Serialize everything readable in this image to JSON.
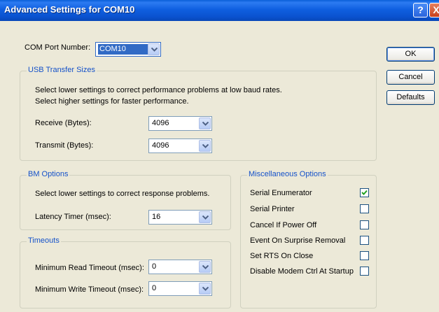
{
  "window": {
    "title": "Advanced Settings for COM10",
    "help_glyph": "?",
    "close_glyph": "X"
  },
  "com_port": {
    "label": "COM Port Number:",
    "value": "COM10"
  },
  "buttons": {
    "ok": "OK",
    "cancel": "Cancel",
    "defaults": "Defaults"
  },
  "usb": {
    "title": "USB Transfer Sizes",
    "line1": "Select lower settings to correct performance problems at low baud rates.",
    "line2": "Select higher settings for faster performance.",
    "receive_label": "Receive (Bytes):",
    "receive_value": "4096",
    "transmit_label": "Transmit (Bytes):",
    "transmit_value": "4096"
  },
  "bm": {
    "title": "BM Options",
    "line1": "Select lower settings to correct response problems.",
    "latency_label": "Latency Timer (msec):",
    "latency_value": "16"
  },
  "timeouts": {
    "title": "Timeouts",
    "read_label": "Minimum Read Timeout (msec):",
    "read_value": "0",
    "write_label": "Minimum Write Timeout (msec):",
    "write_value": "0"
  },
  "misc": {
    "title": "Miscellaneous Options",
    "options": [
      {
        "label": "Serial Enumerator",
        "checked": true
      },
      {
        "label": "Serial Printer",
        "checked": false
      },
      {
        "label": "Cancel If Power Off",
        "checked": false
      },
      {
        "label": "Event On Surprise Removal",
        "checked": false
      },
      {
        "label": "Set RTS On Close",
        "checked": false
      },
      {
        "label": "Disable Modem Ctrl At Startup",
        "checked": false
      }
    ]
  },
  "icons": {
    "dropdown": "chevron-down-icon",
    "check": "checkmark-icon"
  },
  "colors": {
    "titlebar": "#0a52cf",
    "group_label": "#1451c9",
    "dialog_bg": "#ece9d8",
    "check": "#21a121"
  }
}
